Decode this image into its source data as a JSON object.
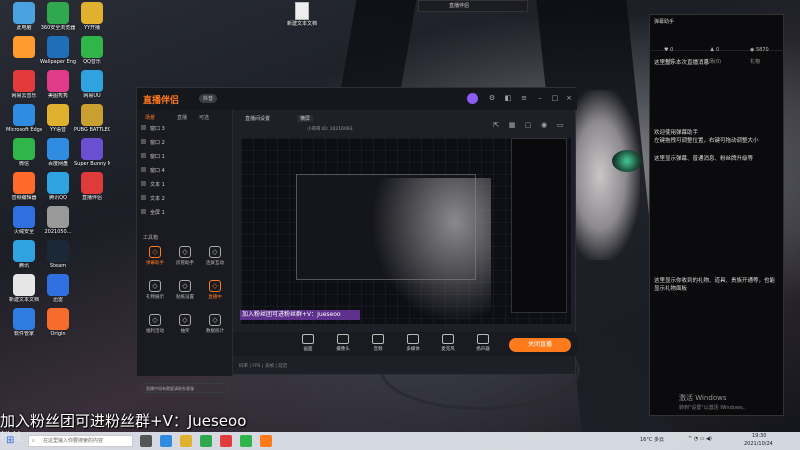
{
  "desktop": {
    "icons": [
      {
        "label": "此电脑",
        "color": "#4aa3df"
      },
      {
        "label": "",
        "color": "#ff9b2f"
      },
      {
        "label": "网易云音乐",
        "color": "#e33b3b"
      },
      {
        "label": "Microsoft Edge",
        "color": "#2f8ce0"
      },
      {
        "label": "微信",
        "color": "#2fb54a"
      },
      {
        "label": "音频编辑器",
        "color": "#ff6a2a"
      },
      {
        "label": "火绒安全",
        "color": "#2f6fe0"
      },
      {
        "label": "腾讯",
        "color": "#2fa3e0"
      },
      {
        "label": "新建文本文档",
        "color": "#e6e6e6"
      },
      {
        "label": "软件管家",
        "color": "#2f7de0"
      },
      {
        "label": "360安全浏览器",
        "color": "#2fa850"
      },
      {
        "label": "Wallpaper Engine",
        "color": "#1f6fb8"
      },
      {
        "label": "美图秀秀",
        "color": "#e03b8a"
      },
      {
        "label": "YY语音",
        "color": "#e0b02f"
      },
      {
        "label": "百度网盘",
        "color": "#2f8ce0"
      },
      {
        "label": "腾讯QQ",
        "color": "#2fa3e0"
      },
      {
        "label": "2021050...",
        "color": "#999999"
      },
      {
        "label": "Steam",
        "color": "#1b2838"
      },
      {
        "label": "迅雷",
        "color": "#2f6fe0"
      },
      {
        "label": "Origin",
        "color": "#f56c2d"
      },
      {
        "label": "YY开播",
        "color": "#e0b02f"
      },
      {
        "label": "QQ音乐",
        "color": "#2fb54a"
      },
      {
        "label": "网易UU",
        "color": "#2fa3e0"
      },
      {
        "label": "PUBG BATTLEGR...",
        "color": "#c9a02f"
      },
      {
        "label": "Super Bunny Man",
        "color": "#6a4fd0"
      },
      {
        "label": "直播伴侣",
        "color": "#e03b3b"
      }
    ],
    "new_doc_label": "新建文本文档",
    "top_window_title": "直播伴侣"
  },
  "app": {
    "logo": "直播伴侣",
    "badge": "抖音",
    "sidebar_tabs": [
      "场景",
      "直播",
      "可选"
    ],
    "scenes": [
      "窗口 3",
      "窗口 2",
      "窗口 1",
      "窗口 4",
      "文本 1",
      "文本 2",
      "全屏 1"
    ],
    "tool_group_label": "工具箱",
    "tools": [
      {
        "label": "弹幕助手",
        "hot": true
      },
      {
        "label": "房管助手",
        "hot": false
      },
      {
        "label": "连屏互动",
        "hot": false
      },
      {
        "label": "礼物展示",
        "hot": false
      },
      {
        "label": "贴纸设置",
        "hot": false
      },
      {
        "label": "直播中",
        "hot": true
      },
      {
        "label": "福利活动",
        "hot": false
      },
      {
        "label": "抽奖",
        "hot": false
      },
      {
        "label": "数据统计",
        "hot": false
      }
    ],
    "top_labels": [
      "直播间设置",
      "横屏"
    ],
    "live_info": "小哥哥 ID: 10216093",
    "notice": "直播中如有需要请联系客服",
    "bottom_items": [
      "画面",
      "摄像头",
      "音频",
      "多媒体",
      "麦克风",
      "扬声器"
    ],
    "go_live_label": "关闭直播",
    "status": "码率 | FPS | 丢帧 | 延迟"
  },
  "chat": {
    "title": "弹幕助手",
    "stats": [
      {
        "icon": "heart",
        "value": "0"
      },
      {
        "icon": "user",
        "value": "0"
      },
      {
        "icon": "eye",
        "value": "5870"
      }
    ],
    "tabs": [
      "全部",
      "进场(0)",
      "礼物"
    ],
    "messages": [
      "这里显示本次直播消息",
      "欢迎使用弹幕助手",
      "左键拖拽可调整位置，右键可拖动调整大小",
      "这里显示弹幕、普通消息、粉丝牌升级等",
      "这里显示你收到的礼物、道具、贵族开通等，也能显示礼物面板"
    ]
  },
  "overlay": {
    "danmu": "加入粉丝团可进粉丝群+V：Jueseoo",
    "caption": "加入粉丝团可进粉丝群+V：Jueseoo",
    "caption_sub": "粉丝"
  },
  "taskbar": {
    "search_placeholder": "在这里输入你要搜索的内容",
    "weather": "16°C 多云",
    "time": "19:30",
    "date": "2021/10/24"
  },
  "windows_activate": {
    "line1": "激活 Windows",
    "line2": "转到\"设置\"以激活 Windows。"
  }
}
